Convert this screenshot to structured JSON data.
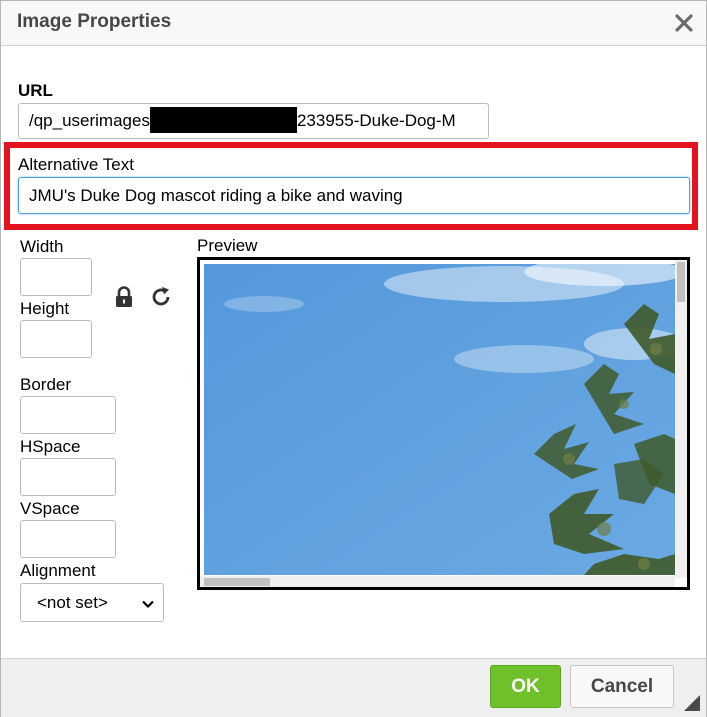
{
  "dialog": {
    "title": "Image Properties"
  },
  "url": {
    "label": "URL",
    "value_prefix": "/qp_userimages",
    "value_suffix": "233955-Duke-Dog-M"
  },
  "alt_text": {
    "label": "Alternative Text",
    "value": "JMU's Duke Dog mascot riding a bike and waving"
  },
  "dimensions": {
    "width_label": "Width",
    "height_label": "Height",
    "width_value": "",
    "height_value": ""
  },
  "spacing": {
    "border_label": "Border",
    "hspace_label": "HSpace",
    "vspace_label": "VSpace",
    "border_value": "",
    "hspace_value": "",
    "vspace_value": ""
  },
  "alignment": {
    "label": "Alignment",
    "selected": "<not set>"
  },
  "preview": {
    "label": "Preview"
  },
  "footer": {
    "ok_label": "OK",
    "cancel_label": "Cancel"
  },
  "colors": {
    "ok_green": "#6fc02a",
    "highlight_red": "#e3141f",
    "focus_blue": "#4aa3df",
    "sky_blue": "#5c9fdc"
  },
  "icons": {
    "close": "close-icon",
    "lock": "lock-icon",
    "reset": "reset-size-icon",
    "dropdown": "chevron-down-icon",
    "resize": "resize-handle-icon"
  }
}
